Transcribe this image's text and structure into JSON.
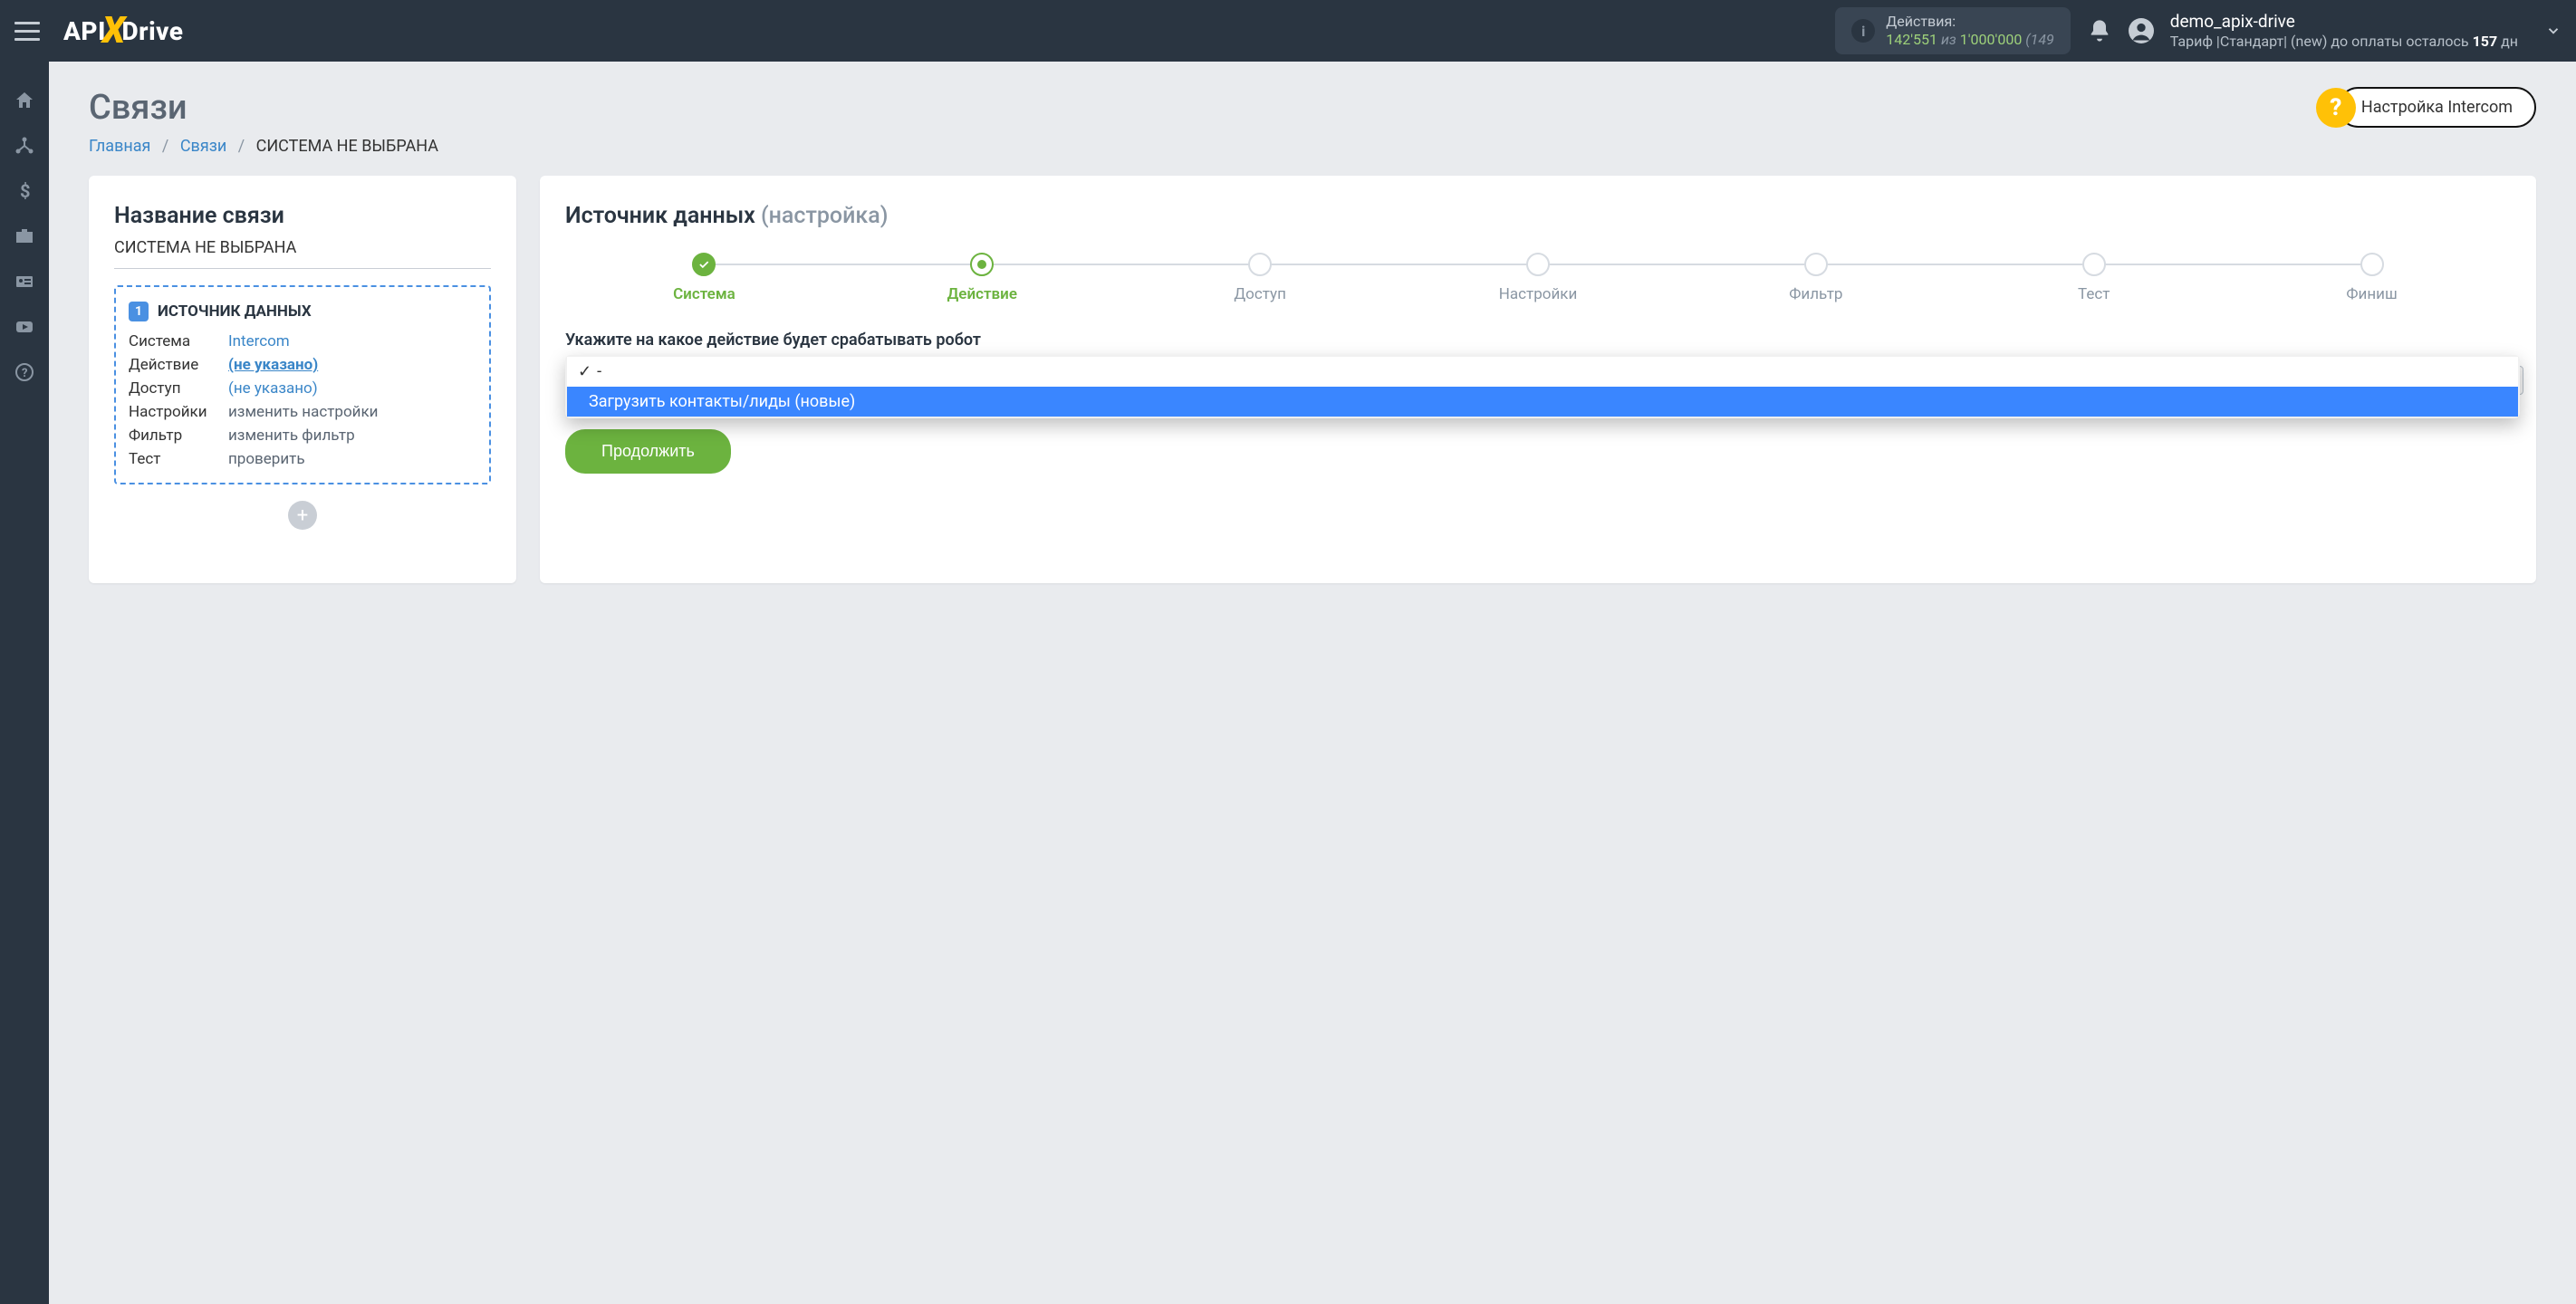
{
  "topbar": {
    "logo_prefix": "API",
    "logo_x": "X",
    "logo_suffix": "Drive",
    "actions_label": "Действия:",
    "actions_count": "142'551",
    "actions_sep": "из",
    "actions_total": "1'000'000",
    "actions_tail": "(149",
    "user_name": "demo_apix-drive",
    "user_plan_prefix": "Тариф |Стандарт| (new) до оплаты осталось ",
    "user_plan_days": "157",
    "user_plan_suffix": " дн"
  },
  "page": {
    "title": "Связи",
    "intercom_btn": "Настройка Intercom"
  },
  "breadcrumb": {
    "home": "Главная",
    "links": "Связи",
    "current": "СИСТЕМА НЕ ВЫБРАНА"
  },
  "left_card": {
    "title": "Название связи",
    "subtitle": "СИСТЕМА НЕ ВЫБРАНА",
    "box_num": "1",
    "box_title": "ИСТОЧНИК ДАННЫХ",
    "rows": [
      {
        "label": "Система",
        "value": "Intercom",
        "kind": "link"
      },
      {
        "label": "Действие",
        "value": "(не указано)",
        "kind": "bold-u"
      },
      {
        "label": "Доступ",
        "value": "(не указано)",
        "kind": "link"
      },
      {
        "label": "Настройки",
        "value": "изменить настройки",
        "kind": "muted"
      },
      {
        "label": "Фильтр",
        "value": "изменить фильтр",
        "kind": "muted"
      },
      {
        "label": "Тест",
        "value": "проверить",
        "kind": "muted"
      }
    ]
  },
  "right_card": {
    "title_main": "Источник данных",
    "title_sub": "(настройка)",
    "steps": [
      {
        "label": "Система",
        "state": "done"
      },
      {
        "label": "Действие",
        "state": "active"
      },
      {
        "label": "Доступ",
        "state": ""
      },
      {
        "label": "Настройки",
        "state": ""
      },
      {
        "label": "Фильтр",
        "state": ""
      },
      {
        "label": "Тест",
        "state": ""
      },
      {
        "label": "Финиш",
        "state": ""
      }
    ],
    "field_label": "Укажите на какое действие будет срабатывать робот",
    "dropdown": {
      "opt_selected": "-",
      "opt_highlighted": "Загрузить контакты/лиды (новые)"
    },
    "continue_btn": "Продолжить"
  }
}
